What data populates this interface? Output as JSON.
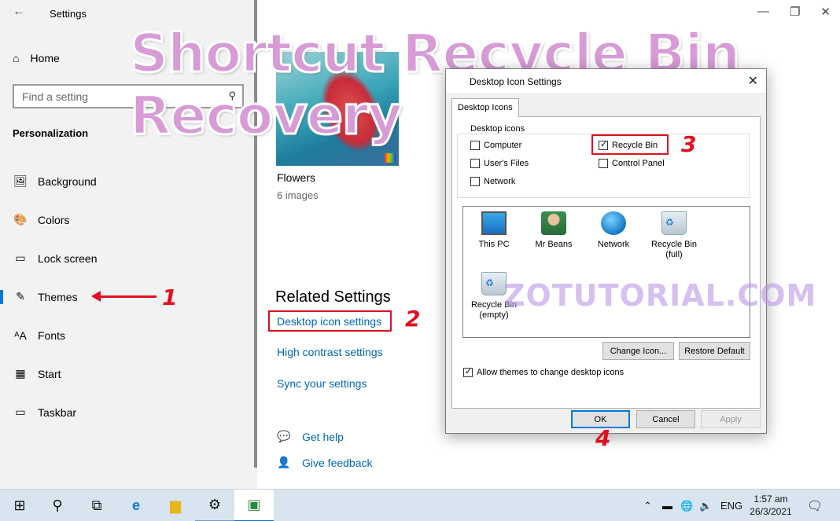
{
  "window": {
    "title": "Settings",
    "back": "←",
    "minimize": "—",
    "restore": "❐",
    "close": "✕"
  },
  "sidebar": {
    "home_label": "Home",
    "search_placeholder": "Find a setting",
    "section_title": "Personalization",
    "items": [
      {
        "label": "Background",
        "icon": "🖼"
      },
      {
        "label": "Colors",
        "icon": "🎨"
      },
      {
        "label": "Lock screen",
        "icon": "▭"
      },
      {
        "label": "Themes",
        "icon": "✎",
        "active": true
      },
      {
        "label": "Fonts",
        "icon": "ᴬA"
      },
      {
        "label": "Start",
        "icon": "▦"
      },
      {
        "label": "Taskbar",
        "icon": "▭"
      }
    ]
  },
  "main": {
    "theme_name": "Flowers",
    "theme_count": "6 images",
    "related_title": "Related Settings",
    "links": {
      "desktop_icons": "Desktop icon settings",
      "high_contrast": "High contrast settings",
      "sync": "Sync your settings"
    },
    "help": {
      "get_help": "Get help",
      "feedback": "Give feedback"
    }
  },
  "dialog": {
    "title": "Desktop Icon Settings",
    "tab_label": "Desktop Icons",
    "group_label": "Desktop icons",
    "checkboxes": {
      "computer": {
        "label": "Computer",
        "checked": false
      },
      "user_files": {
        "label": "User's Files",
        "checked": false
      },
      "network": {
        "label": "Network",
        "checked": false
      },
      "recycle_bin": {
        "label": "Recycle Bin",
        "checked": true
      },
      "control_panel": {
        "label": "Control Panel",
        "checked": false
      }
    },
    "icons": [
      {
        "label": "This PC",
        "sub": ""
      },
      {
        "label": "Mr Beans",
        "sub": ""
      },
      {
        "label": "Network",
        "sub": ""
      },
      {
        "label": "Recycle Bin",
        "sub": "(full)"
      },
      {
        "label": "Recycle Bin",
        "sub": "(empty)"
      }
    ],
    "change_icon": "Change Icon...",
    "restore_default": "Restore Default",
    "allow_themes": {
      "label": "Allow themes to change desktop icons",
      "checked": true
    },
    "ok": "OK",
    "cancel": "Cancel",
    "apply": "Apply"
  },
  "annotations": {
    "title_line1": "Shortcut Recycle Bin",
    "title_line2": "Recovery",
    "n1": "1",
    "n2": "2",
    "n3": "3",
    "n4": "4",
    "watermark": "ZOTUTORIAL.COM",
    "accent": "#e01020"
  },
  "taskbar": {
    "tray_lang": "ENG",
    "time": "1:57 am",
    "date": "26/3/2021"
  },
  "colors": {
    "link": "#0067b8",
    "accent": "#0078d7",
    "sidebar_bg": "#f2f2f2"
  }
}
